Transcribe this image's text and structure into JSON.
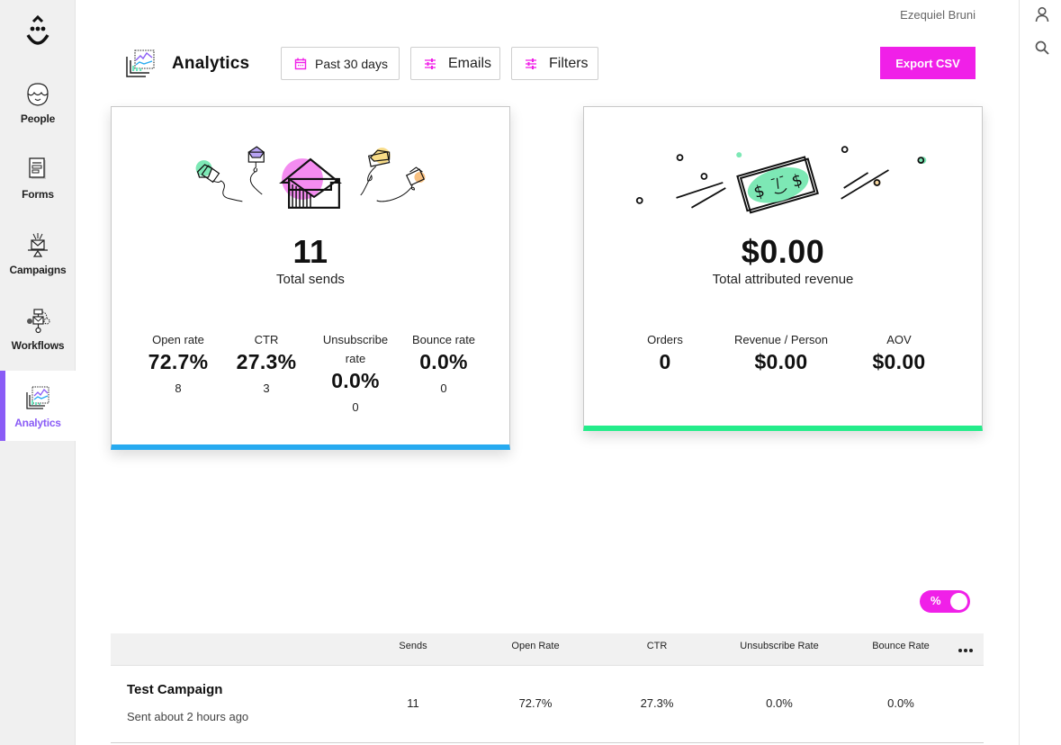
{
  "sidebar": {
    "items": [
      {
        "label": "People",
        "icon": "person-face-icon",
        "active": false
      },
      {
        "label": "Forms",
        "icon": "form-document-icon",
        "active": false
      },
      {
        "label": "Campaigns",
        "icon": "campaign-envelope-icon",
        "active": false
      },
      {
        "label": "Workflows",
        "icon": "workflow-icon",
        "active": false
      },
      {
        "label": "Analytics",
        "icon": "analytics-chart-icon",
        "active": true
      }
    ]
  },
  "user": {
    "name": "Ezequiel Bruni"
  },
  "right_rail": {
    "icons": [
      "user-icon",
      "search-icon"
    ]
  },
  "header": {
    "title": "Analytics",
    "date_filter": "Past 30 days",
    "emails_button": "Emails",
    "filters_button": "Filters",
    "export_button": "Export CSV"
  },
  "colors": {
    "accent_magenta": "#f020e8",
    "active_purple": "#8a5cf6",
    "sends_bar": "#27aaf0",
    "revenue_bar": "#24ec8a"
  },
  "sends_card": {
    "total": "11",
    "total_label": "Total sends",
    "stats": [
      {
        "label": "Open rate",
        "value": "72.7%",
        "count": "8"
      },
      {
        "label": "CTR",
        "value": "27.3%",
        "count": "3"
      },
      {
        "label": "Unsubscribe rate",
        "value": "0.0%",
        "count": "0"
      },
      {
        "label": "Bounce rate",
        "value": "0.0%",
        "count": "0"
      }
    ]
  },
  "revenue_card": {
    "total": "$0.00",
    "total_label": "Total attributed revenue",
    "stats": [
      {
        "label": "Orders",
        "value": "0"
      },
      {
        "label": "Revenue / Person",
        "value": "$0.00"
      },
      {
        "label": "AOV",
        "value": "$0.00"
      }
    ]
  },
  "toggle": {
    "label": "%",
    "on": true
  },
  "table": {
    "columns": [
      "Sends",
      "Open Rate",
      "CTR",
      "Unsubscribe Rate",
      "Bounce Rate"
    ],
    "rows": [
      {
        "name": "Test Campaign",
        "subtitle": "Sent about 2 hours ago",
        "sends": "11",
        "open_rate": "72.7%",
        "ctr": "27.3%",
        "unsubscribe_rate": "0.0%",
        "bounce_rate": "0.0%"
      }
    ]
  }
}
